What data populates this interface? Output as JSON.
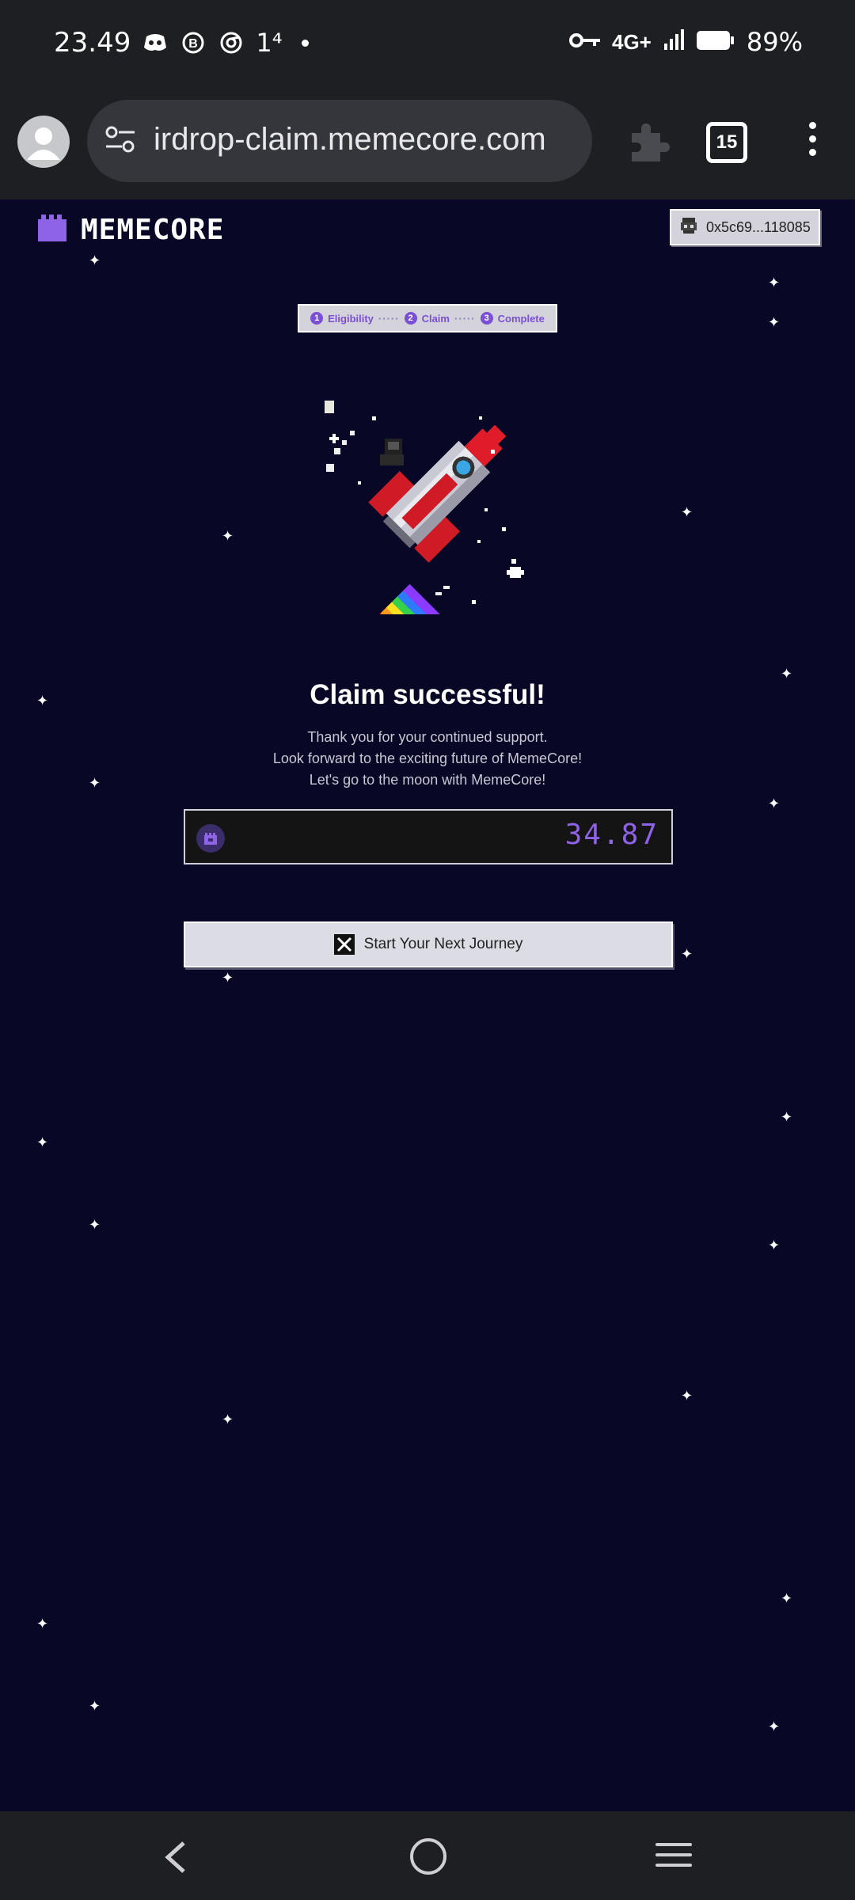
{
  "status_bar": {
    "time": "23.49",
    "notification_icons": [
      "discord-icon",
      "b-circle-icon",
      "chrome-icon"
    ],
    "badge": "1⁴",
    "network": "4G+",
    "battery_percent": "89%"
  },
  "browser": {
    "url": "irdrop-claim.memecore.com",
    "tab_count": "15"
  },
  "header": {
    "logo_text": "MEMECORE",
    "wallet_address": "0x5c69...118085"
  },
  "stepper": {
    "steps": [
      {
        "num": "1",
        "label": "Eligibility"
      },
      {
        "num": "2",
        "label": "Claim"
      },
      {
        "num": "3",
        "label": "Complete"
      }
    ],
    "separator": "·····"
  },
  "main": {
    "title": "Claim successful!",
    "subtitle_lines": [
      "Thank you for your continued support.",
      "Look forward to the exciting future of MemeCore!",
      "Let's go to the moon with MemeCore!"
    ],
    "claimed_amount": "34.87",
    "journey_button_label": "Start Your Next Journey"
  },
  "colors": {
    "background": "#080725",
    "accent": "#8f63e6",
    "system_bar": "#1e1f22"
  }
}
